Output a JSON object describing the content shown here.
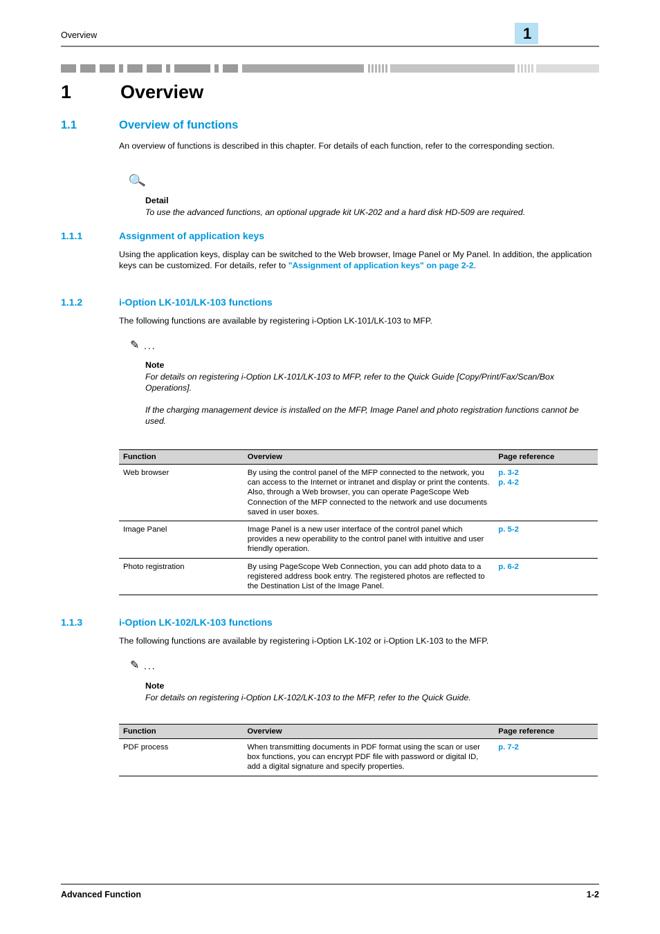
{
  "header": {
    "title": "Overview",
    "chapter_number": "1"
  },
  "chapter": {
    "number": "1",
    "title": "Overview"
  },
  "sections": {
    "s1_1": {
      "number": "1.1",
      "title": "Overview of functions",
      "intro": "An overview of functions is described in this chapter. For details of each function, refer to the corresponding section.",
      "detail_label": "Detail",
      "detail_text": "To use the advanced functions, an optional upgrade kit UK-202 and a hard disk HD-509 are required."
    },
    "s1_1_1": {
      "number": "1.1.1",
      "title": "Assignment of application keys",
      "body_1": "Using the application keys, display can be switched to the Web browser, Image Panel or My Panel. In addition, the application keys can be customized. For details, refer to ",
      "link_text": "\"Assignment of application keys\" on page 2-2",
      "body_2": "."
    },
    "s1_1_2": {
      "number": "1.1.2",
      "title": "i-Option LK-101/LK-103 functions",
      "body": "The following functions are available by registering i-Option LK-101/LK-103 to MFP.",
      "note_label": "Note",
      "note_text_1": "For details on registering i-Option LK-101/LK-103 to MFP, refer to the Quick Guide [Copy/Print/Fax/Scan/Box Operations].",
      "note_text_2": "If the charging management device is installed on the MFP, Image Panel and photo registration functions cannot be used."
    },
    "s1_1_3": {
      "number": "1.1.3",
      "title": "i-Option LK-102/LK-103 functions",
      "body": "The following functions are available by registering i-Option LK-102 or i-Option LK-103 to the MFP.",
      "note_label": "Note",
      "note_text_1": "For details on registering i-Option LK-102/LK-103 to the MFP, refer to the Quick Guide."
    }
  },
  "table_1": {
    "headers": [
      "Function",
      "Overview",
      "Page reference"
    ],
    "rows": [
      {
        "function": "Web browser",
        "overview": "By using the control panel of the MFP connected to the network, you can access to the Internet or intranet and display or print the contents.\nAlso, through a Web browser, you can operate PageScope Web Connection of the MFP connected to the network and use documents saved in user boxes.",
        "page_refs": [
          "p. 3-2",
          "p. 4-2"
        ]
      },
      {
        "function": "Image Panel",
        "overview": "Image Panel is a new user interface of the control panel which provides a new operability to the control panel with intuitive and user friendly operation.",
        "page_refs": [
          "p. 5-2"
        ]
      },
      {
        "function": "Photo registration",
        "overview": "By using PageScope Web Connection, you can add photo data to a registered address book entry. The registered photos are reflected to the Destination List of the Image Panel.",
        "page_refs": [
          "p. 6-2"
        ]
      }
    ]
  },
  "table_2": {
    "headers": [
      "Function",
      "Overview",
      "Page reference"
    ],
    "rows": [
      {
        "function": "PDF process",
        "overview": "When transmitting documents in PDF format using the scan or user box functions, you can encrypt PDF file with password or digital ID, add a digital signature and specify properties.",
        "page_refs": [
          "p. 7-2"
        ]
      }
    ]
  },
  "footer": {
    "left": "Advanced Function",
    "right": "1-2"
  },
  "icons": {
    "detail": "magnifier-icon",
    "note": "pencil-icon",
    "dots": "..."
  },
  "colors": {
    "accent": "#0096dc",
    "chapter_box": "#b5e0f5",
    "rule": "#7d7d7d",
    "table_header": "#d4d4d4"
  }
}
